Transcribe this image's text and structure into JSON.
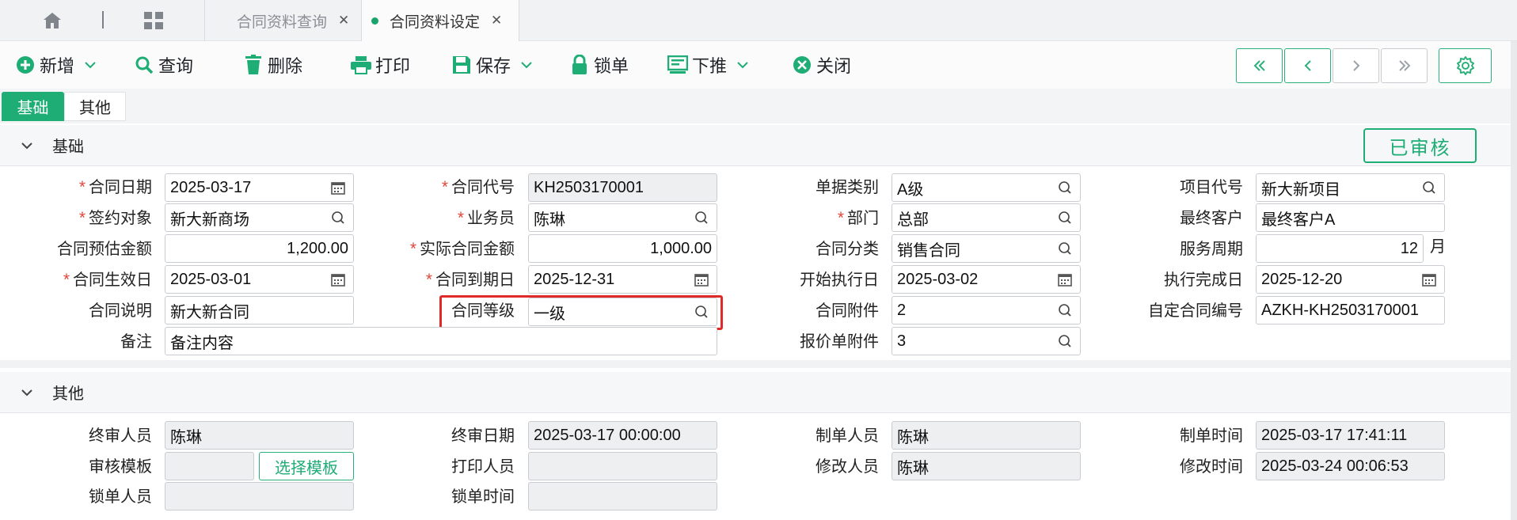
{
  "tabs": [
    {
      "label": "合同资料查询",
      "active": false
    },
    {
      "label": "合同资料设定",
      "active": true
    }
  ],
  "tab_close_glyph": "✕",
  "toolbar": {
    "new": "新增",
    "query": "查询",
    "delete": "删除",
    "print": "打印",
    "save": "保存",
    "lock": "锁单",
    "push_down": "下推",
    "close": "关闭"
  },
  "subtabs": [
    "基础",
    "其他"
  ],
  "sections": {
    "basic": "基础",
    "other": "其他"
  },
  "status": "已审核",
  "form": {
    "contract_date": {
      "label": "合同日期",
      "value": "2025-03-17"
    },
    "contract_code": {
      "label": "合同代号",
      "value": "KH2503170001"
    },
    "doc_category": {
      "label": "单据类别",
      "value": "A级"
    },
    "project_code": {
      "label": "项目代号",
      "value": "新大新项目"
    },
    "sign_target": {
      "label": "签约对象",
      "value": "新大新商场"
    },
    "salesperson": {
      "label": "业务员",
      "value": "陈琳"
    },
    "department": {
      "label": "部门",
      "value": "总部"
    },
    "final_customer": {
      "label": "最终客户",
      "value": "最终客户A"
    },
    "est_amount": {
      "label": "合同预估金额",
      "value": "1,200.00"
    },
    "actual_amount": {
      "label": "实际合同金额",
      "value": "1,000.00"
    },
    "contract_type": {
      "label": "合同分类",
      "value": "销售合同"
    },
    "service_period": {
      "label": "服务周期",
      "value": "12",
      "unit": "月"
    },
    "effective_date": {
      "label": "合同生效日",
      "value": "2025-03-01"
    },
    "expiry_date": {
      "label": "合同到期日",
      "value": "2025-12-31"
    },
    "start_exec": {
      "label": "开始执行日",
      "value": "2025-03-02"
    },
    "exec_done": {
      "label": "执行完成日",
      "value": "2025-12-20"
    },
    "description": {
      "label": "合同说明",
      "value": "新大新合同"
    },
    "grade": {
      "label": "合同等级",
      "value": "一级"
    },
    "attachment": {
      "label": "合同附件",
      "value": "2"
    },
    "custom_no": {
      "label": "自定合同编号",
      "value": "AZKH-KH2503170001"
    },
    "remark": {
      "label": "备注",
      "value": "备注内容"
    },
    "quote_attachment": {
      "label": "报价单附件",
      "value": "3"
    }
  },
  "other": {
    "final_reviewer": {
      "label": "终审人员",
      "value": "陈琳"
    },
    "final_review_date": {
      "label": "终审日期",
      "value": "2025-03-17 00:00:00"
    },
    "creator": {
      "label": "制单人员",
      "value": "陈琳"
    },
    "create_time": {
      "label": "制单时间",
      "value": "2025-03-17 17:41:11"
    },
    "review_template": {
      "label": "审核模板",
      "value": ""
    },
    "select_template": "选择模板",
    "printer": {
      "label": "打印人员",
      "value": ""
    },
    "modifier": {
      "label": "修改人员",
      "value": "陈琳"
    },
    "modify_time": {
      "label": "修改时间",
      "value": "2025-03-24 00:06:53"
    },
    "locker": {
      "label": "锁单人员",
      "value": ""
    },
    "lock_time": {
      "label": "锁单时间",
      "value": ""
    }
  },
  "colors": {
    "accent": "#1fad76",
    "required": "#e0473d",
    "highlight": "#e02a2a"
  },
  "icons": [
    "home-icon",
    "grid-icon",
    "close-icon",
    "plus-circle-icon",
    "search-icon",
    "trash-icon",
    "printer-icon",
    "floppy-icon",
    "lock-icon",
    "push-down-icon",
    "close-circle-icon",
    "chevron-down-icon",
    "first-page-icon",
    "prev-page-icon",
    "next-page-icon",
    "last-page-icon",
    "gear-icon",
    "calendar-icon"
  ]
}
